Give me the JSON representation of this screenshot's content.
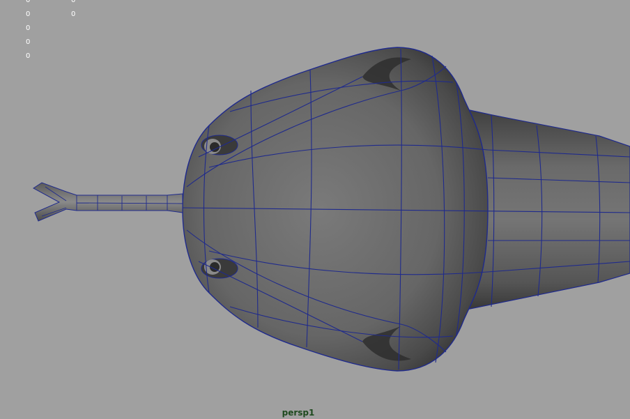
{
  "viewport": {
    "camera_name": "persp1",
    "background_color": "#a0a0a0",
    "wireframe_color": "#1f2a8c",
    "mesh_color": "#6e6e6e"
  },
  "hud": {
    "left_values": [
      "0",
      "0",
      "0",
      "0",
      "0"
    ],
    "right_values": [
      "0",
      "0"
    ]
  }
}
